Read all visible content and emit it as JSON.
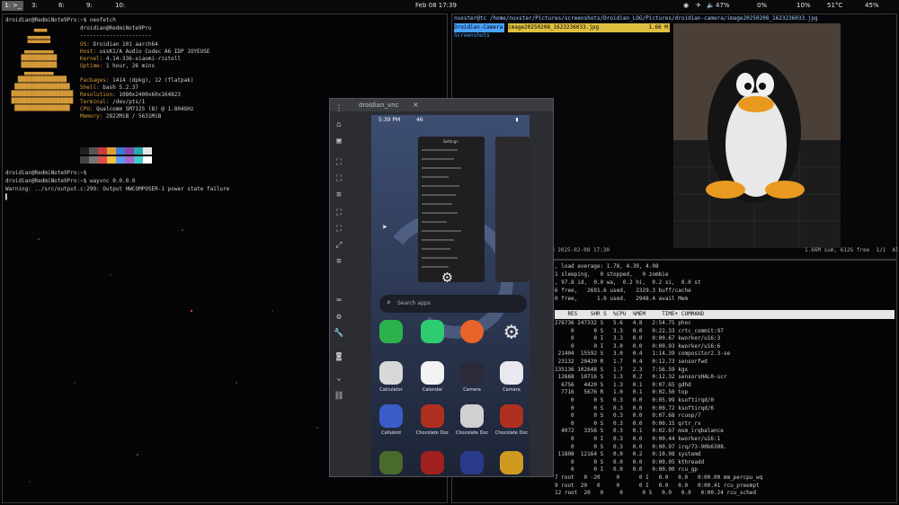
{
  "topbar": {
    "workspaces": [
      {
        "label": "1: >_",
        "focused": true
      },
      {
        "label": "3:",
        "focused": false
      },
      {
        "label": "6:",
        "focused": false
      },
      {
        "label": "9:",
        "focused": false
      },
      {
        "label": "10:",
        "focused": false
      }
    ],
    "clock": "Feb 08 17:39",
    "tray": [
      "47%",
      "0%",
      "10%",
      "51°C",
      "45%"
    ]
  },
  "terminal_left": {
    "prompt1": "droidian@RedmiNote9Pro:~$ neofetch",
    "userhost": "droidian@RedmiNote9Pro",
    "separator": "----------------------",
    "info": [
      {
        "key": "OS:",
        "value": "Droidian 101 aarch64"
      },
      {
        "key": "Host:",
        "value": "ussK1/A Audio Codec A6 IDP JOYEUSE"
      },
      {
        "key": "Kernel:",
        "value": "4.14-336-xiaomi-ristoll"
      },
      {
        "key": "Uptime:",
        "value": "1 hour, 26 mins"
      },
      {
        "key": "",
        "value": ""
      },
      {
        "key": "Packages:",
        "value": "1414 (dpkg), 12 (flatpak)"
      },
      {
        "key": "Shell:",
        "value": "bash 5.2.37"
      },
      {
        "key": "Resolution:",
        "value": "1080x2400x60x164823"
      },
      {
        "key": "Terminal:",
        "value": "/dev/pts/1"
      },
      {
        "key": "CPU:",
        "value": "Qualcomm SM7125 (8) @ 1.804GHz"
      },
      {
        "key": "Memory:",
        "value": "2822MiB / 5631MiB"
      }
    ],
    "prompt2": "droidian@RedmiNote9Pro:~$",
    "prompt3": "droidian@RedmiNote9Pro:~$ wayvnc 0.0.0.0",
    "warning": "Warning: ../src/output.c:299: Output HWCOMPOSER-1 power state failure",
    "cursor": "▌"
  },
  "scrcpy": {
    "title": "droidian_vnc",
    "status_time": "5:39 PM",
    "status_net": "46",
    "search_placeholder": "Search apps",
    "apps": [
      {
        "name": "Calculator",
        "color": "#d8d8d8"
      },
      {
        "name": "Calendar",
        "color": "#f2f2f2"
      },
      {
        "name": "Camera",
        "color": "#2a2a3a"
      },
      {
        "name": "Camera",
        "color": "#e8e8ee"
      },
      {
        "name": "Celluloid",
        "color": "#3b5dc9"
      },
      {
        "name": "Chocolate Doc",
        "color": "#b03020"
      },
      {
        "name": "Chocolate Doc",
        "color": "#d0d0d0"
      },
      {
        "name": "Chocolate Doc",
        "color": "#b03020"
      }
    ],
    "recent_window_title": "Settings"
  },
  "ranger": {
    "path": "nuxster@tc /home/nuxster/Pictures/screenshots/Droidian_LOG/Pictures/droidian-camera/image20250208_1623236033.jpg",
    "col1_items": [
      "Droidian-Camera",
      "Screenshots"
    ],
    "col2_selected": "image20250208_1623236033.jpg",
    "col2_size": "1.66 M",
    "footer_left": "M 2025-02-08 17:30",
    "footer_right": "1.66M sum, 612G free  1/1  All"
  },
  "htop": {
    "top_lines": [
      ", load average: 1.78, 4.39, 4.08",
      "1 sleeping,   0 stopped,   0 zombie",
      ", 97.8 id,  0.0 wa,  0.2 hi,  0.2 si,  0.0 st",
      "6 free,   2691.6 used,   2329.3 buff/cache",
      "0 free,      1.0 used.   2948.4 avail Mem"
    ],
    "header": "    RES    SHR S  %CPU  %MEM     TIME+ COMMAND",
    "rows": [
      "276736 247332 S   5.6   4.8   2:54.75 phoc",
      "     0      0 S   3.3   0.0   0:22.33 crtc_commit:97",
      "     0      0 I   3.3   0.0   0:00.67 kworker/u16:3",
      "     0      0 I   3.0   0.0   0:00.93 kworker/u16:6",
      " 21404  15592 S   3.0   0.4   1:14.39 compositor2.3-se",
      " 23132  20420 R   1.7   0.4   0:12.73 sensorfwd",
      "135136 102648 S   1.7   2.3   7:56.59 kgx",
      " 12668  10716 S   1.3   0.2   0:12.32 sensorsHAL0-scr",
      "  6756   4420 S   1.3   0.1   0:07.65 gdhd",
      "  7716   5676 R   1.0   0.1   0:02.50 top",
      "     0      0 S   0.3   0.0   0:05.99 ksoftirqd/0",
      "     0      0 S   0.3   0.0   0:00.72 ksoftirqd/6",
      "     0      0 S   0.3   0.0   0:07.68 rcuop/7",
      "     0      0 S   0.3   0.0   0:00.15 qrtr_rx",
      "  4072   3356 S   0.3   0.1   0:02.67 msm_irqbalance",
      "     0      0 I   0.3   0.0   0:00.44 kworker/u16:1",
      "     0      0 S   0.3   0.0   0:00.97 irq/73-90b6308.",
      " 11808  12164 S   0.0   0.2   0:10.98 systemd",
      "     0      0 S   0.0   0.0   0:00.05 kthreadd",
      "     0      0 I   0.0   0.0   0:00.00 rcu_gp",
      "7 root   0 -20     0      0 I   0.0   0.0   0:00.00 mm_percpu_wq",
      "9 root  20   0     0      0 I   0.0   0.0   0:00.41 rcu_preempt",
      "12 root  20   0     0      0 S   0.0   0.0   0:00.24 rcu_sched"
    ]
  },
  "colors": {
    "accent": "#4aa3ff",
    "ascii": "#d49a3a",
    "bg": "#050507"
  }
}
